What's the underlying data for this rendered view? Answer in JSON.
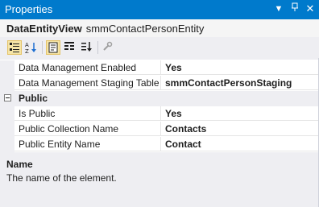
{
  "window": {
    "title": "Properties",
    "buttons": {
      "dropdown": "▼",
      "pin": "📌",
      "close": "✕"
    }
  },
  "object": {
    "type": "DataEntityView",
    "name": "smmContactPersonEntity"
  },
  "toolbar": {
    "tools": [
      {
        "name": "categorized",
        "icon": "categorized-icon",
        "selected": true
      },
      {
        "name": "alphabetical",
        "icon": "sort-az-icon",
        "selected": false
      },
      {
        "name": "properties",
        "icon": "properties-icon",
        "selected": true
      },
      {
        "name": "events",
        "icon": "events-icon",
        "selected": false
      },
      {
        "name": "property-pages",
        "icon": "property-pages-icon",
        "selected": false
      },
      {
        "name": "settings",
        "icon": "wrench-icon",
        "selected": false
      }
    ]
  },
  "grid": {
    "rows_top": [
      {
        "name": "Data Management Enabled",
        "value": "Yes"
      },
      {
        "name": "Data Management Staging Table",
        "value": "smmContactPersonStaging"
      }
    ],
    "category": {
      "label": "Public",
      "expanded": true
    },
    "rows_public": [
      {
        "name": "Is Public",
        "value": "Yes"
      },
      {
        "name": "Public Collection Name",
        "value": "Contacts"
      },
      {
        "name": "Public Entity Name",
        "value": "Contact"
      }
    ]
  },
  "description": {
    "title": "Name",
    "text": "The name of the element."
  },
  "colors": {
    "titlebar": "#007acc",
    "panel": "#eeeef2",
    "selected_tool": "#f5e4a6"
  }
}
